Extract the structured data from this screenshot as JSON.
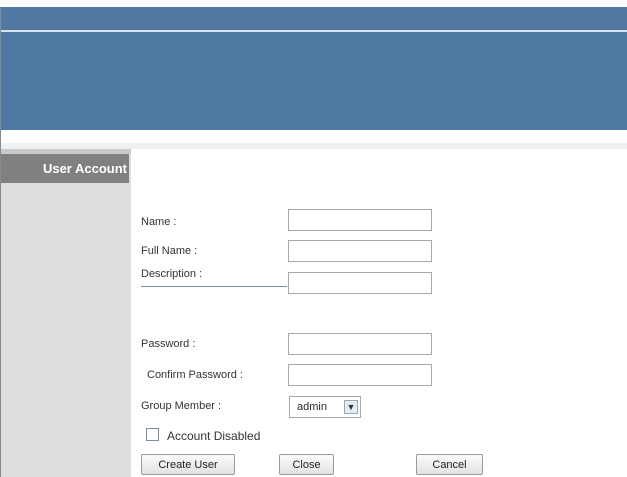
{
  "sidebar": {
    "title": "User Account"
  },
  "form": {
    "name_label": "Name :",
    "name_value": "",
    "fullname_label": "Full Name :",
    "fullname_value": "",
    "description_label": "Description :",
    "description_value": "",
    "password_label": "Password :",
    "password_value": "",
    "confirm_label": "Confirm Password :",
    "confirm_value": "",
    "group_label": "Group Member :",
    "group_value": "admin",
    "disabled_label": "Account Disabled",
    "disabled_checked": false
  },
  "buttons": {
    "create": "Create User",
    "close": "Close",
    "cancel": "Cancel"
  },
  "colors": {
    "banner": "#4f78a3",
    "sidebar_title_bg": "#808080",
    "sidebar_bg": "#dedede"
  },
  "icons": {
    "select_arrow": "chevron-down-icon"
  }
}
